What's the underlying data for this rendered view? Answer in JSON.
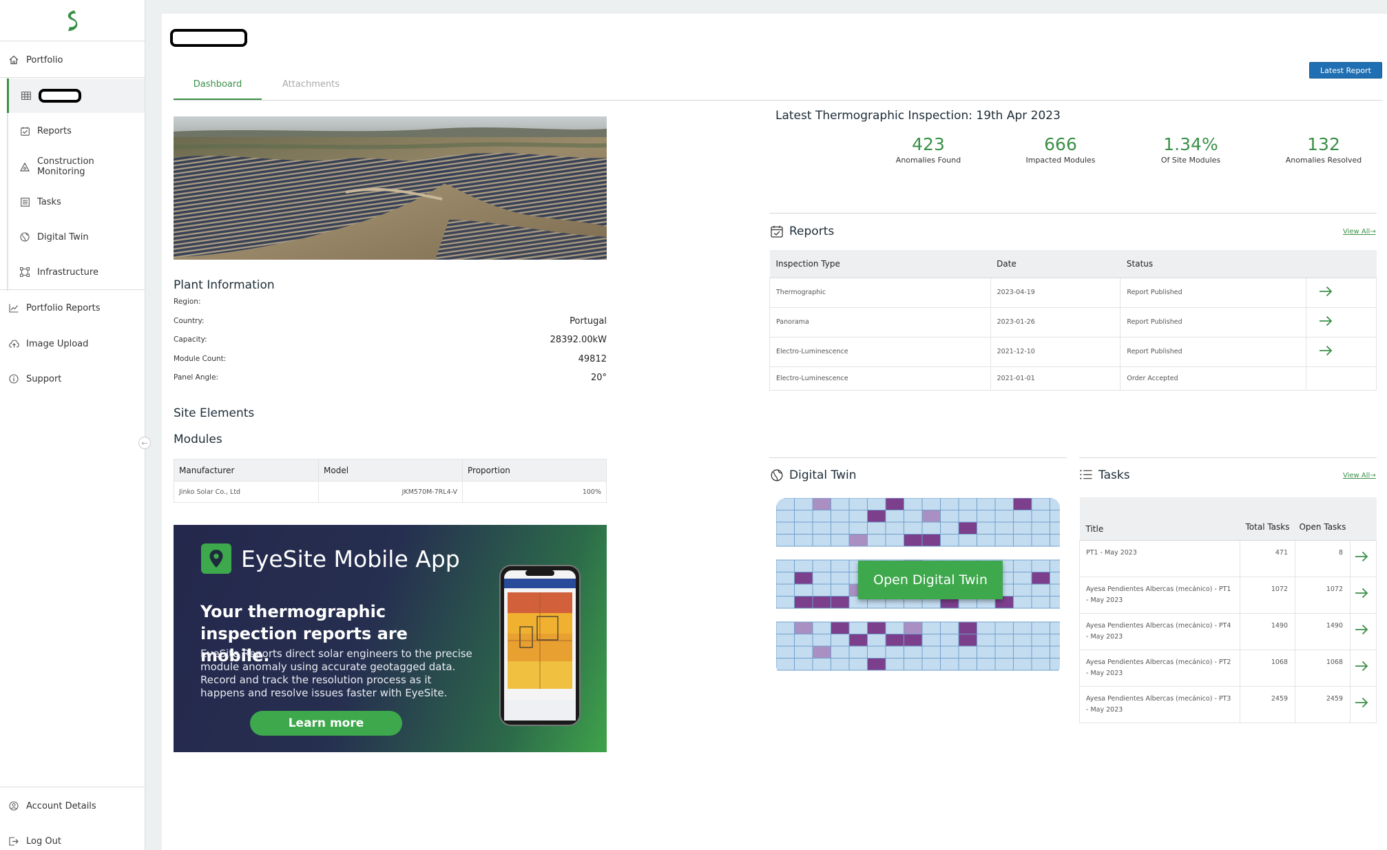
{
  "sidebar": {
    "top_items": [
      {
        "label": "Portfolio",
        "icon": "home-icon"
      }
    ],
    "sub_items": [
      {
        "label": "Reports",
        "icon": "calendar-icon"
      },
      {
        "label": "Construction Monitoring",
        "icon": "warning-triangle-icon"
      },
      {
        "label": "Tasks",
        "icon": "task-list-icon"
      },
      {
        "label": "Digital Twin",
        "icon": "globe-icon"
      },
      {
        "label": "Infrastructure",
        "icon": "vector-square-icon"
      }
    ],
    "bottom_items": [
      {
        "label": "Portfolio Reports",
        "icon": "chart-line-icon"
      },
      {
        "label": "Image Upload",
        "icon": "cloud-upload-icon"
      },
      {
        "label": "Support",
        "icon": "info-icon"
      }
    ],
    "account_details": "Account Details",
    "log_out": "Log Out"
  },
  "tabs": {
    "dashboard": "Dashboard",
    "attachments": "Attachments"
  },
  "latest_report_button": "Latest Report",
  "plant_info": {
    "title": "Plant Information",
    "rows": [
      {
        "label": "Region:",
        "value": ""
      },
      {
        "label": "Country:",
        "value": "Portugal"
      },
      {
        "label": "Capacity:",
        "value": "28392.00kW"
      },
      {
        "label": "Module Count:",
        "value": "49812"
      },
      {
        "label": "Panel Angle:",
        "value": "20°"
      }
    ]
  },
  "site_elements_title": "Site Elements",
  "modules": {
    "title": "Modules",
    "headers": [
      "Manufacturer",
      "Model",
      "Proportion"
    ],
    "rows": [
      [
        "Jinko Solar Co., Ltd",
        "JKM570M-7RL4-V",
        "100%"
      ]
    ]
  },
  "banner": {
    "title": "EyeSite Mobile App",
    "headline": "Your thermographic inspection reports are mobile.",
    "body": "EyeSite Reports direct solar engineers to the precise module anomaly using accurate geotagged data. Record and track the resolution process as it happens and resolve issues faster with EyeSite.",
    "cta": "Learn more"
  },
  "inspection": {
    "title": "Latest Thermographic Inspection: 19th Apr 2023",
    "kpis": [
      {
        "value": "423",
        "caption": "Anomalies Found"
      },
      {
        "value": "666",
        "caption": "Impacted Modules"
      },
      {
        "value": "1.34%",
        "caption": "Of Site Modules"
      },
      {
        "value": "132",
        "caption": "Anomalies Resolved"
      }
    ]
  },
  "reports": {
    "title": "Reports",
    "view_all": "View All",
    "headers": [
      "Inspection Type",
      "Date",
      "Status"
    ],
    "rows": [
      {
        "type": "Thermographic",
        "date": "2023-04-19",
        "status": "Report Published",
        "has_arrow": true
      },
      {
        "type": "Panorama",
        "date": "2023-01-26",
        "status": "Report Published",
        "has_arrow": true
      },
      {
        "type": "Electro-Luminescence",
        "date": "2021-12-10",
        "status": "Report Published",
        "has_arrow": true
      },
      {
        "type": "Electro-Luminescence",
        "date": "2021-01-01",
        "status": "Order Accepted",
        "has_arrow": false
      }
    ]
  },
  "digital_twin": {
    "title": "Digital Twin",
    "button": "Open Digital Twin"
  },
  "tasks": {
    "title": "Tasks",
    "view_all": "View All",
    "headers": [
      "Title",
      "Total Tasks",
      "Open Tasks"
    ],
    "rows": [
      {
        "title": "PT1 - May 2023",
        "total": "471",
        "open": "8"
      },
      {
        "title": "Ayesa Pendientes Albercas (mecánico) - PT1 - May 2023",
        "total": "1072",
        "open": "1072"
      },
      {
        "title": "Ayesa Pendientes Albercas (mecánico) - PT4 - May 2023",
        "total": "1490",
        "open": "1490"
      },
      {
        "title": "Ayesa Pendientes Albercas (mecánico) - PT2 - May 2023",
        "total": "1068",
        "open": "1068"
      },
      {
        "title": "Ayesa Pendientes Albercas (mecánico) - PT3 - May 2023",
        "total": "2459",
        "open": "2459"
      }
    ]
  },
  "colors": {
    "accent": "#3a8f47",
    "button_blue": "#1f6fb2",
    "anomaly": "#7b3f8c",
    "module": "#c4dcf0"
  }
}
